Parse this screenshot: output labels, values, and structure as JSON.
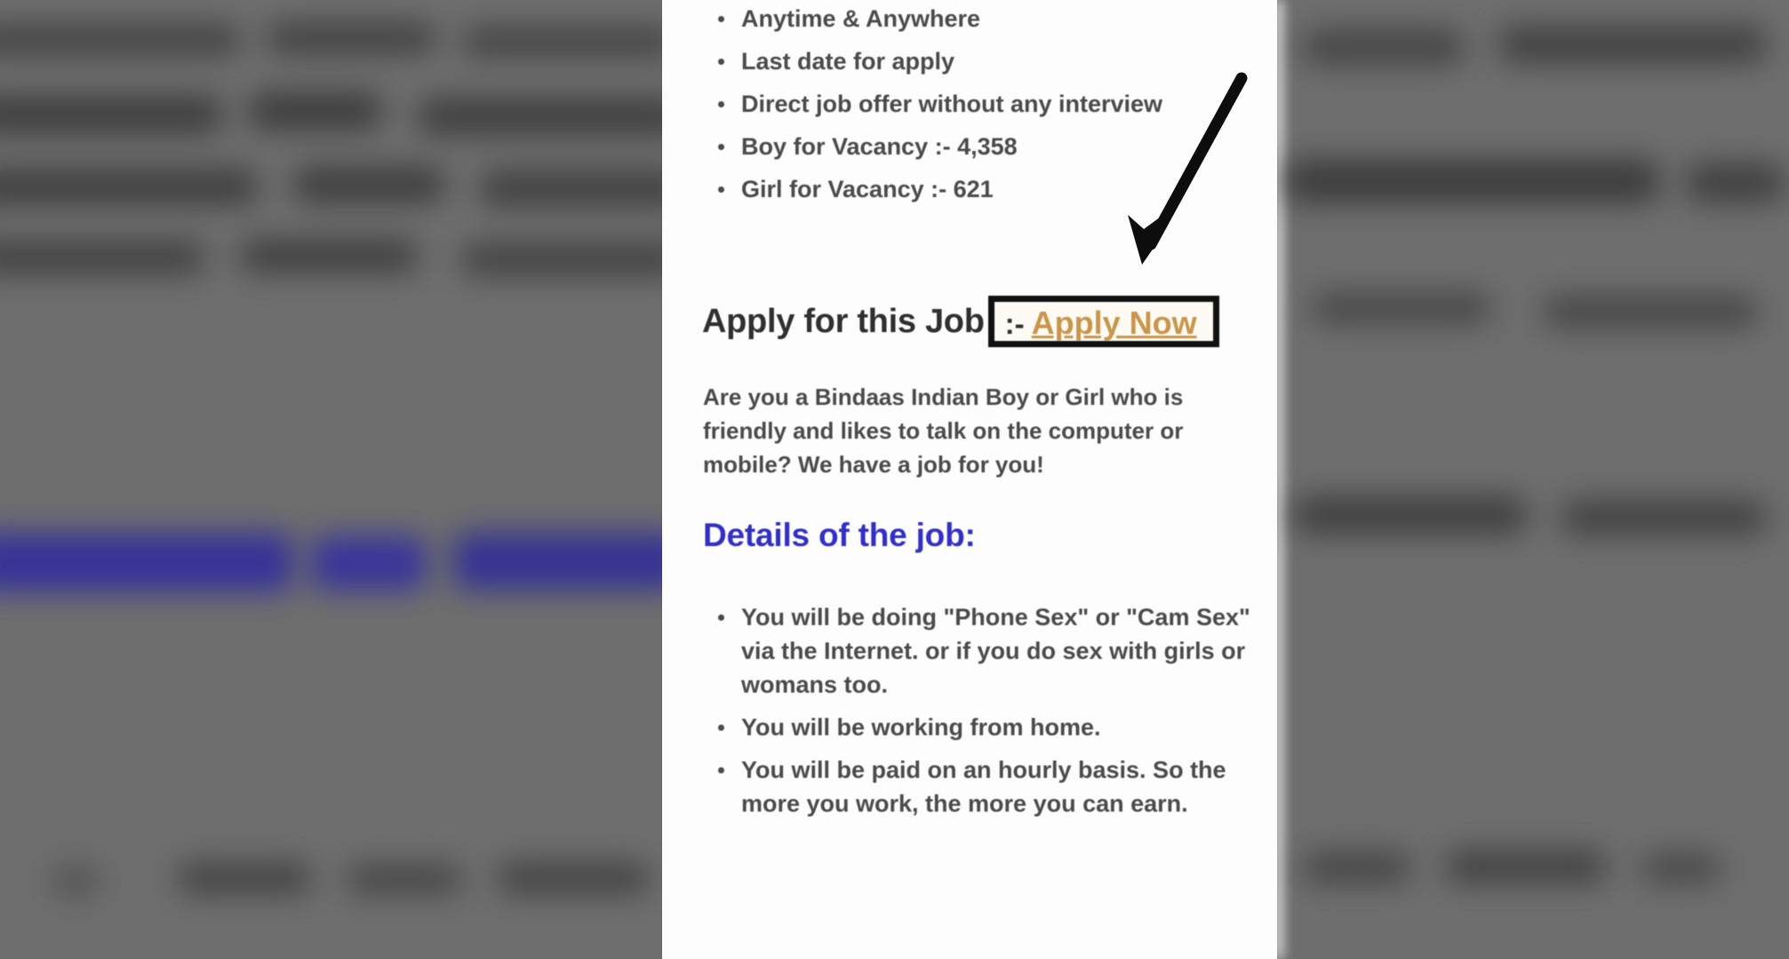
{
  "background": {
    "description": "blurred out-of-focus webpage behind the foreground card",
    "base_color": "#6e6e6e",
    "accent_blue": "#3b3a8c"
  },
  "card": {
    "background_color": "#fdfdfd",
    "top_bullets": [
      "Anytime & Anywhere",
      "Last date for apply",
      "Direct job offer  without any interview",
      "Boy for Vacancy :- 4,358",
      "Girl for Vacancy :- 621"
    ],
    "apply_section": {
      "heading": "Apply for this Job",
      "separator": ":-",
      "button_label": "Apply Now",
      "button_text_color": "#c8954a",
      "box_border_color": "#111111"
    },
    "intro_paragraph": "Are you a Bindaas Indian Boy or Girl who is friendly and likes to talk on the computer or mobile? We have a job for you!",
    "details_heading": "Details of the job",
    "details_heading_colon": ":",
    "details_heading_color": "#3230c4",
    "detail_bullets": [
      "You will be doing \"Phone Sex\" or \"Cam Sex\" via the Internet. or if you do sex with girls or womans too.",
      "You will be working from home.",
      "You will be paid on an hourly basis. So the more you work, the more you can earn."
    ],
    "bottom_heading_cutoff": ""
  },
  "annotation": {
    "arrow": "hand-drawn black arrow pointing down-left toward the Apply Now button",
    "arrow_color": "#0d0d0d",
    "highlight": "black rectangle drawn around the Apply Now link"
  }
}
